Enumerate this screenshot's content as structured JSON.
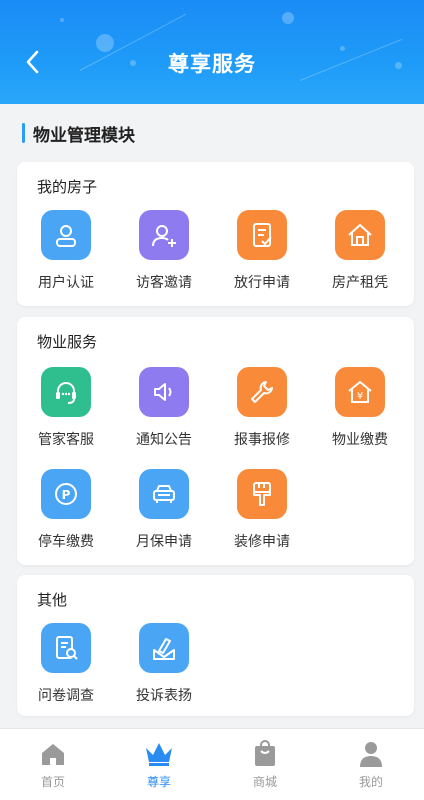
{
  "header": {
    "title": "尊享服务"
  },
  "module_title": "物业管理模块",
  "sections": [
    {
      "title": "我的房子",
      "items": [
        {
          "label": "用户认证",
          "icon": "user-icon",
          "color": "#4aa6f5"
        },
        {
          "label": "访客邀请",
          "icon": "user-add-icon",
          "color": "#8e7bf0"
        },
        {
          "label": "放行申请",
          "icon": "document-check-icon",
          "color": "#f98a3a"
        },
        {
          "label": "房产租凭",
          "icon": "house-icon",
          "color": "#f98a3a"
        }
      ]
    },
    {
      "title": "物业服务",
      "items": [
        {
          "label": "管家客服",
          "icon": "headset-icon",
          "color": "#2fbf8f"
        },
        {
          "label": "通知公告",
          "icon": "speaker-icon",
          "color": "#8e7bf0"
        },
        {
          "label": "报事报修",
          "icon": "wrench-icon",
          "color": "#f98a3a"
        },
        {
          "label": "物业缴费",
          "icon": "yen-house-icon",
          "color": "#f98a3a"
        },
        {
          "label": "停车缴费",
          "icon": "parking-icon",
          "color": "#4aa6f5"
        },
        {
          "label": "月保申请",
          "icon": "car-icon",
          "color": "#4aa6f5"
        },
        {
          "label": "装修申请",
          "icon": "paint-brush-icon",
          "color": "#f98a3a"
        }
      ]
    },
    {
      "title": "其他",
      "items": [
        {
          "label": "问卷调查",
          "icon": "survey-icon",
          "color": "#4aa6f5"
        },
        {
          "label": "投诉表扬",
          "icon": "pen-envelope-icon",
          "color": "#4aa6f5"
        }
      ]
    }
  ],
  "bottom_nav": [
    {
      "label": "首页",
      "icon": "home-icon",
      "active": false
    },
    {
      "label": "尊享",
      "icon": "crown-icon",
      "active": true
    },
    {
      "label": "商城",
      "icon": "shopping-bag-icon",
      "active": false
    },
    {
      "label": "我的",
      "icon": "person-icon",
      "active": false
    }
  ],
  "colors": {
    "primary": "#1b8cf6",
    "active_nav": "#2a8cf0",
    "inactive_nav": "#999999"
  }
}
